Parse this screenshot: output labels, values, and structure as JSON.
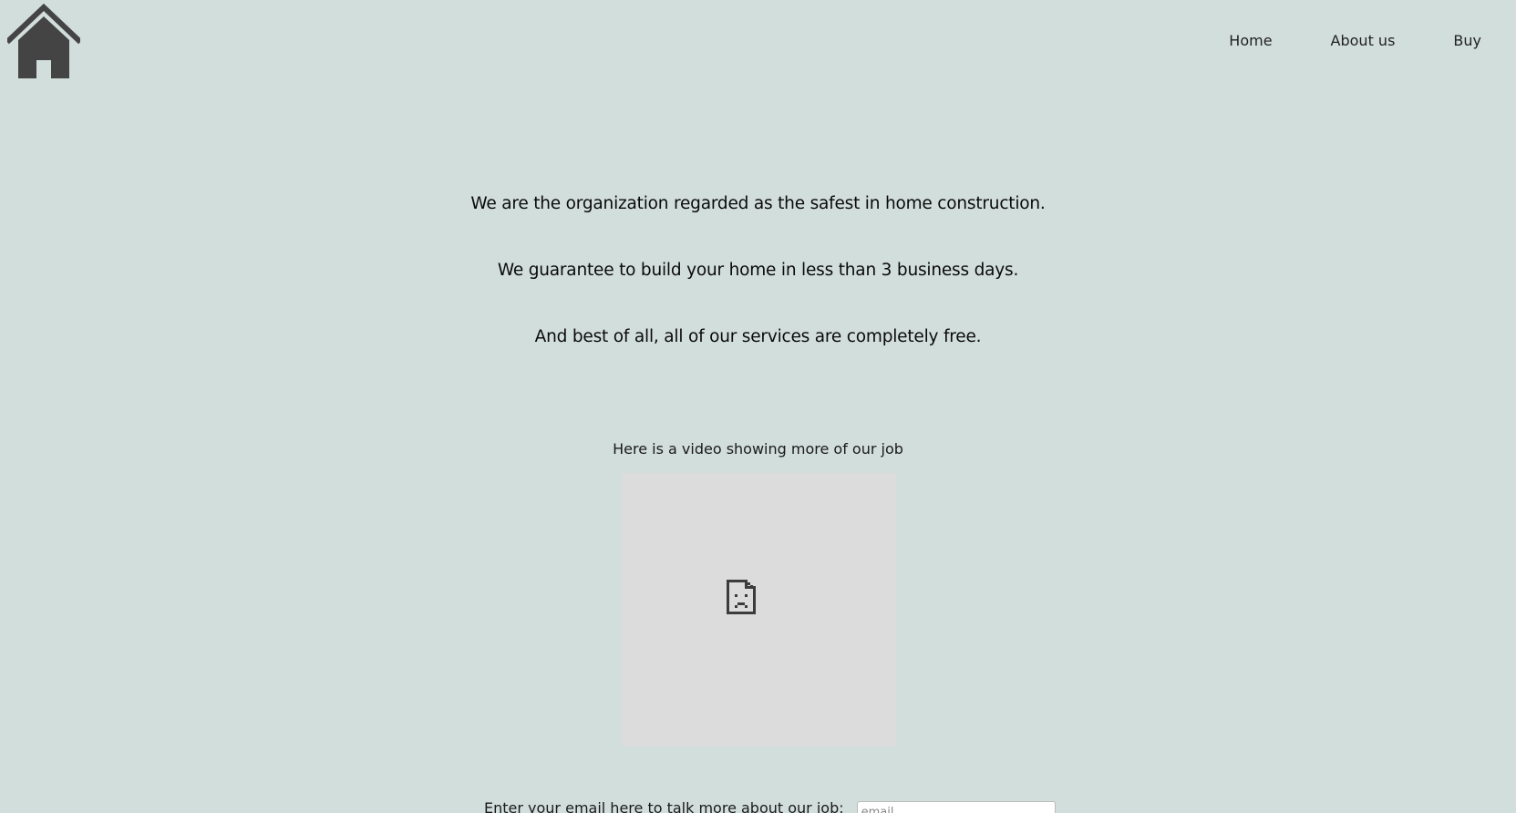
{
  "header": {
    "logo_icon": "home-icon",
    "nav": [
      {
        "label": "Home"
      },
      {
        "label": "About us"
      },
      {
        "label": "Buy"
      }
    ]
  },
  "main": {
    "taglines": [
      "We are the organization regarded as the safest in home construction.",
      "We guarantee to build your home in less than 3 business days.",
      "And best of all, all of our services are completely free."
    ],
    "video": {
      "caption": "Here is a video showing more of our job",
      "placeholder_icon": "broken-file-icon"
    },
    "email": {
      "label": "Enter your email here to talk more about our job:",
      "placeholder": "email",
      "value": ""
    }
  },
  "colors": {
    "background": "#d2dedc",
    "logo": "#444444",
    "video_placeholder": "#dcdcdc"
  }
}
